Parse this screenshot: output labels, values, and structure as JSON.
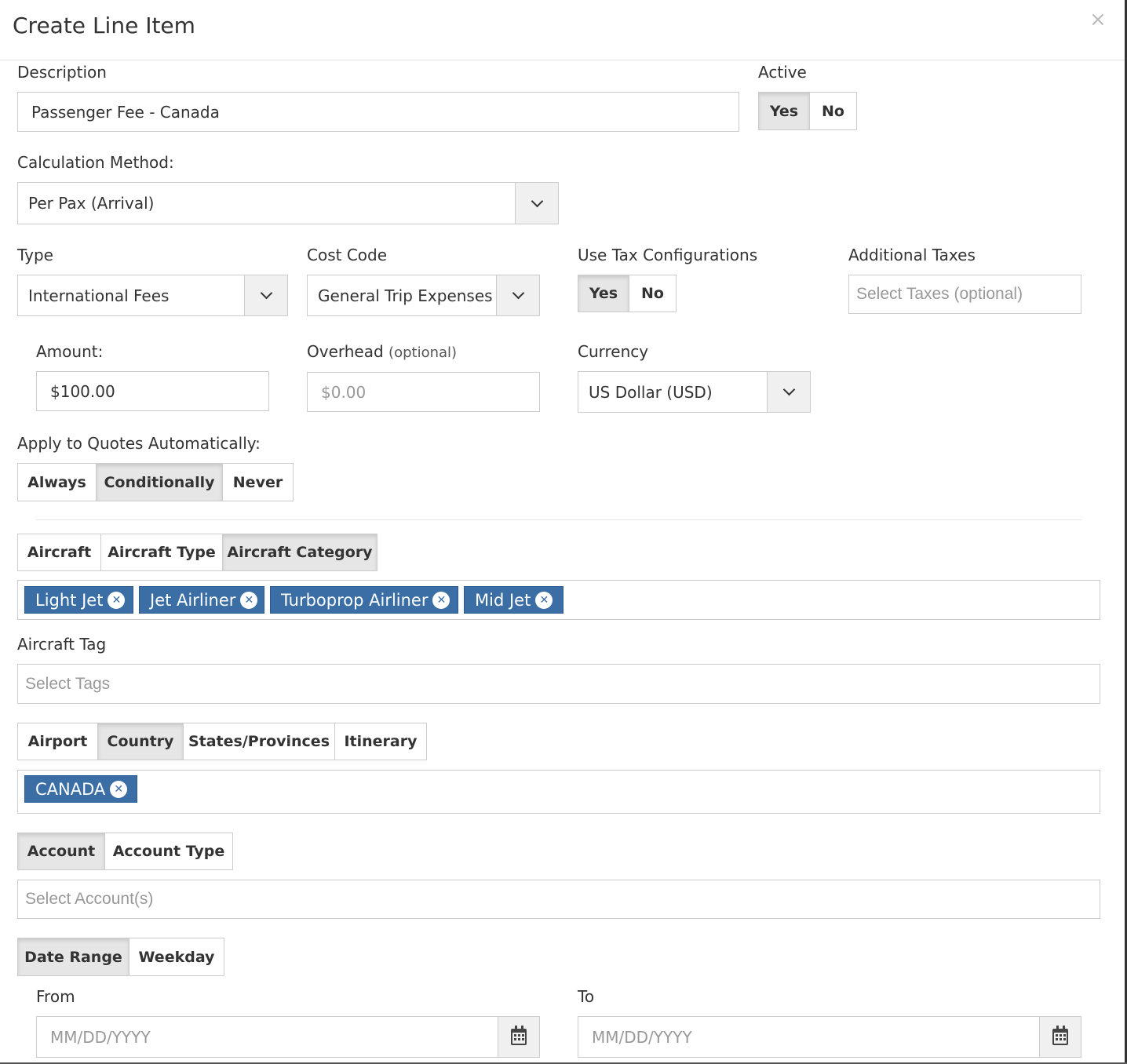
{
  "modal": {
    "title": "Create Line Item",
    "close": "×"
  },
  "description": {
    "label": "Description",
    "value": "Passenger Fee - Canada"
  },
  "active": {
    "label": "Active",
    "options": [
      "Yes",
      "No"
    ],
    "selected": "Yes"
  },
  "calculation_method": {
    "label": "Calculation Method:",
    "value": "Per Pax (Arrival)"
  },
  "type": {
    "label": "Type",
    "value": "International Fees"
  },
  "cost_code": {
    "label": "Cost Code",
    "value": "General Trip Expenses"
  },
  "use_tax": {
    "label": "Use Tax Configurations",
    "options": [
      "Yes",
      "No"
    ],
    "selected": "Yes"
  },
  "additional_taxes": {
    "label": "Additional Taxes",
    "placeholder": "Select Taxes (optional)"
  },
  "amount": {
    "label": "Amount:",
    "value": "$100.00"
  },
  "overhead": {
    "label": "Overhead",
    "label_optional": "(optional)",
    "placeholder": "$0.00"
  },
  "currency": {
    "label": "Currency",
    "value": "US Dollar (USD)"
  },
  "apply_quotes": {
    "label": "Apply to Quotes Automatically:",
    "options": [
      "Always",
      "Conditionally",
      "Never"
    ],
    "selected": "Conditionally"
  },
  "aircraft_tabs": {
    "options": [
      "Aircraft",
      "Aircraft Type",
      "Aircraft Category"
    ],
    "selected": "Aircraft Category"
  },
  "aircraft_tags": [
    "Light Jet",
    "Jet Airliner",
    "Turboprop Airliner",
    "Mid Jet"
  ],
  "aircraft_tag": {
    "label": "Aircraft Tag",
    "placeholder": "Select Tags"
  },
  "location_tabs": {
    "options": [
      "Airport",
      "Country",
      "States/Provinces",
      "Itinerary"
    ],
    "selected": "Country"
  },
  "location_tags": [
    "CANADA"
  ],
  "account_tabs": {
    "options": [
      "Account",
      "Account Type"
    ],
    "selected": "Account"
  },
  "account": {
    "placeholder": "Select Account(s)"
  },
  "date_tabs": {
    "options": [
      "Date Range",
      "Weekday"
    ],
    "selected": "Date Range"
  },
  "from": {
    "label": "From",
    "placeholder": "MM/DD/YYYY"
  },
  "to": {
    "label": "To",
    "placeholder": "MM/DD/YYYY"
  }
}
